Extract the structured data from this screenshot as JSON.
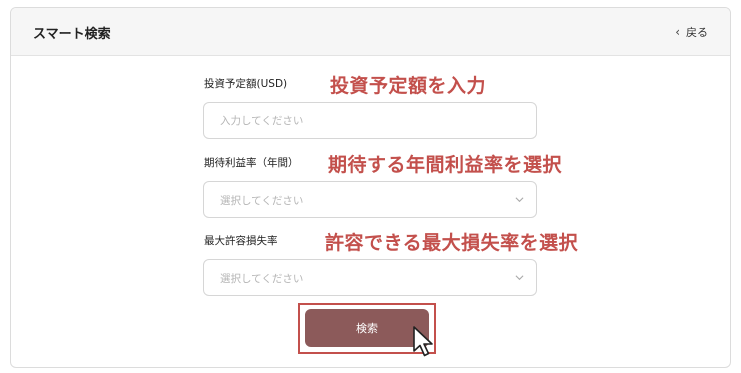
{
  "header": {
    "title": "スマート検索",
    "back_label": "戻る"
  },
  "form": {
    "investment": {
      "label": "投資予定額(USD)",
      "annotation": "投資予定額を入力",
      "placeholder": "入力してください"
    },
    "profit_rate": {
      "label": "期待利益率（年間）",
      "annotation": "期待する年間利益率を選択",
      "placeholder": "選択してください"
    },
    "loss_rate": {
      "label": "最大許容損失率",
      "annotation": "許容できる最大損失率を選択",
      "placeholder": "選択してください"
    },
    "submit_label": "検索"
  },
  "colors": {
    "accent_button": "#8c5a5a",
    "annotation_red": "#c3504c"
  },
  "icons": [
    "chevron-left-icon",
    "chevron-down-icon",
    "mouse-cursor-icon"
  ]
}
